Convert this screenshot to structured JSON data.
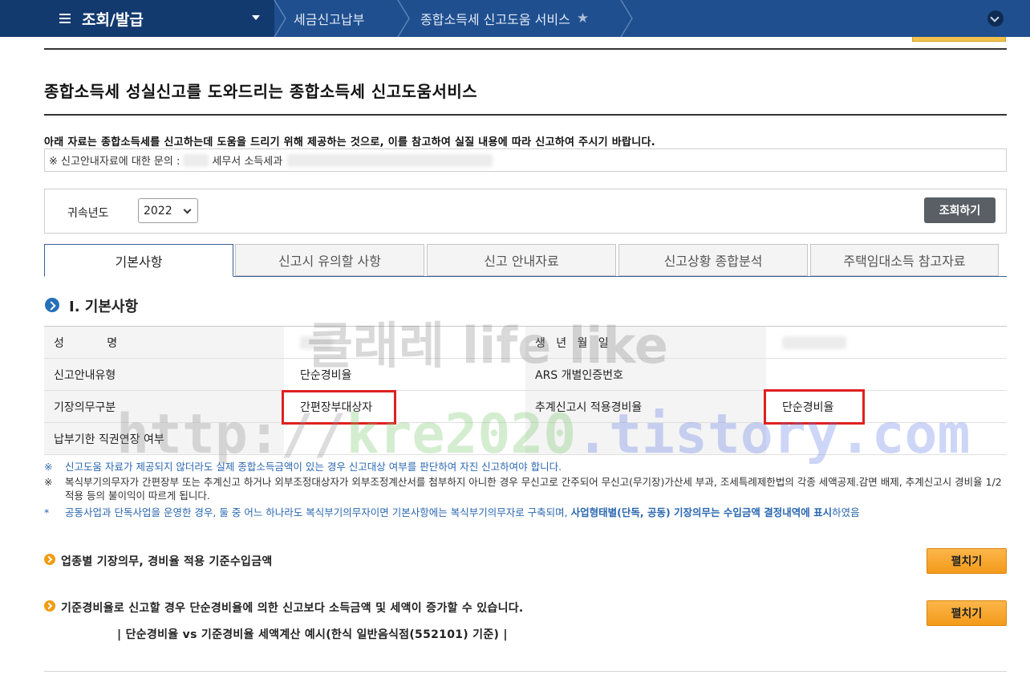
{
  "nav": {
    "main_label": "조회/발급",
    "breadcrumbs": [
      "세금신고납부",
      "종합소득세 신고도움 서비스"
    ]
  },
  "page": {
    "title": "종합소득세 성실신고를 도와드리는 종합소득세 신고도움서비스",
    "notice": "아래 자료는 종합소득세를 신고하는데 도움을 드리기 위해 제공하는 것으로, 이를 참고하여 실질 내용에 따라 신고하여 주시기 바랍니다.",
    "inquiry_prefix": "※ 신고안내자료에 대한 문의 :",
    "inquiry_middle": "세무서 소득세과"
  },
  "search": {
    "year_label": "귀속년도",
    "year_value": "2022",
    "button_label": "조회하기"
  },
  "tabs": [
    {
      "label": "기본사항",
      "active": true
    },
    {
      "label": "신고시 유의할 사항",
      "active": false
    },
    {
      "label": "신고 안내자료",
      "active": false
    },
    {
      "label": "신고상황 종합분석",
      "active": false
    },
    {
      "label": "주택임대소득 참고자료",
      "active": false
    }
  ],
  "section": {
    "title": "Ⅰ. 기본사항",
    "rows": [
      {
        "k1": "성            명",
        "v1": "",
        "k2": "생   년   월   일",
        "v2": ""
      },
      {
        "k1": "신고안내유형",
        "v1": "단순경비율",
        "k2": "ARS 개별인증번호",
        "v2": ""
      },
      {
        "k1": "기장의무구분",
        "v1": "간편장부대상자",
        "k2": "추계신고시 적용경비율",
        "v2": "단순경비율"
      },
      {
        "k1": "납부기한 직권연장 여부",
        "v1": "",
        "k2": "",
        "v2": ""
      }
    ]
  },
  "notes": {
    "n1_mark": "※",
    "n1": "신고도움 자료가 제공되지 않더라도 실제 종합소득금액이 있는 경우 신고대상 여부를 판단하여 자진 신고하여야 합니다.",
    "n2_mark": "※",
    "n2": "복식부기의무자가 간편장부 또는 추계신고 하거나 외부조정대상자가 외부조정계산서를 첨부하지 아니한 경우 무신고로 간주되어 무신고(무기장)가산세 부과, 조세특례제한법의 각종 세액공제.감면 배제, 추계신고시 경비율 1/2적용 등의 불이익이 따르게 됩니다.",
    "n3_mark": "*",
    "n3_a": "공동사업과 단독사업을 운영한 경우, 둘 중 어느 하나라도 복식부기의무자이면 기본사항에는 복식부기의무자로 구축되며, ",
    "n3_bold": "사업형태별(단독, 공동) 기장의무는 수입금액 결정내역에 표시",
    "n3_b": "하였음"
  },
  "expand_rows": [
    {
      "title": "업종별 기장의무, 경비율 적용 기준수입금액",
      "button": "펼치기"
    },
    {
      "title": "기준경비율로 신고할 경우 단순경비율에 의한 신고보다 소득금액 및 세액이 증가할 수 있습니다.",
      "button": "펼치기"
    }
  ],
  "example_title": "| 단순경비율 vs 기준경비율 세액계산 예시(한식 일반음식점(552101) 기준) |",
  "watermarks": {
    "w1": "클래레 life like",
    "w2a": "http://",
    "w2b": "kre2020",
    "w2c": ".tistory.com"
  },
  "colors": {
    "nav_bg": "#1f4f8f",
    "nav_main_bg": "#133a6f",
    "accent_blue": "#2a67b0",
    "button_orange": "#f39a1a",
    "highlight_red": "#e02020"
  }
}
